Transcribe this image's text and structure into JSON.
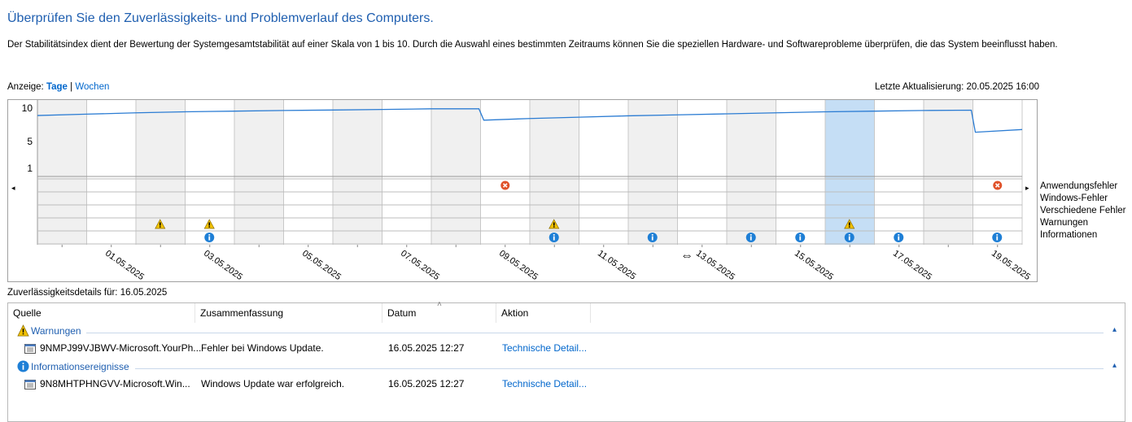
{
  "header": {
    "title": "Überprüfen Sie den Zuverlässigkeits- und Problemverlauf des Computers.",
    "description": "Der Stabilitätsindex dient der Bewertung der Systemgesamtstabilität auf einer Skala von 1 bis 10. Durch die Auswahl eines bestimmten Zeitraums können Sie die speziellen Hardware- und Softwareprobleme überprüfen, die das System beeinflusst haben."
  },
  "view": {
    "label": "Anzeige:",
    "days": "Tage",
    "separator": "|",
    "weeks": "Wochen",
    "last_update": "Letzte Aktualisierung: 20.05.2025 16:00"
  },
  "chart": {
    "y_ticks": [
      "10",
      "5",
      "1"
    ],
    "legend": [
      "Anwendungsfehler",
      "Windows-Fehler",
      "Verschiedene Fehler",
      "Warnungen",
      "Informationen"
    ],
    "nav_left": "◂",
    "nav_right": "▸"
  },
  "chart_data": {
    "type": "line",
    "title": "",
    "ylim": [
      1,
      10
    ],
    "x": [
      "30.04.2025",
      "01.05.2025",
      "02.05.2025",
      "03.05.2025",
      "04.05.2025",
      "05.05.2025",
      "06.05.2025",
      "07.05.2025",
      "08.05.2025",
      "09.05.2025",
      "10.05.2025",
      "11.05.2025",
      "12.05.2025",
      "13.05.2025",
      "14.05.2025",
      "15.05.2025",
      "16.05.2025",
      "17.05.2025",
      "18.05.2025",
      "19.05.2025"
    ],
    "x_tick_labels": [
      "01.05.2025",
      "03.05.2025",
      "05.05.2025",
      "07.05.2025",
      "09.05.2025",
      "11.05.2025",
      "13.05.2025",
      "15.05.2025",
      "17.05.2025",
      "19.05.2025"
    ],
    "series": [
      {
        "values": [
          8.9,
          9.1,
          9.3,
          9.45,
          9.55,
          9.65,
          9.72,
          9.8,
          9.9,
          8.2,
          8.45,
          8.65,
          8.85,
          9.0,
          9.15,
          9.3,
          9.45,
          9.55,
          9.65,
          9.7
        ]
      }
    ],
    "stability_drop_end": 6.4,
    "selected_day": "16.05.2025",
    "events": {
      "Anwendungsfehler": [
        "09.05.2025",
        "19.05.2025"
      ],
      "Windows-Fehler": [],
      "Verschiedene Fehler": [],
      "Warnungen": [
        "02.05.2025",
        "03.05.2025",
        "10.05.2025",
        "16.05.2025"
      ],
      "Informationen": [
        "03.05.2025",
        "10.05.2025",
        "12.05.2025",
        "14.05.2025",
        "15.05.2025",
        "16.05.2025",
        "17.05.2025",
        "19.05.2025"
      ]
    }
  },
  "details": {
    "label": "Zuverlässigkeitsdetails für: 16.05.2025",
    "columns": [
      "Quelle",
      "Zusammenfassung",
      "Datum",
      "Aktion"
    ],
    "groups": [
      {
        "name": "Warnungen",
        "icon": "warning-icon",
        "rows": [
          {
            "source": "9NMPJ99VJBWV-Microsoft.YourPh...",
            "summary": "Fehler bei Windows Update.",
            "date": "16.05.2025 12:27",
            "action": "Technische Detail..."
          }
        ]
      },
      {
        "name": "Informationsereignisse",
        "icon": "info-icon",
        "rows": [
          {
            "source": "9N8MHTPHNGVV-Microsoft.Win...",
            "summary": "Windows Update war erfolgreich.",
            "date": "16.05.2025 12:27",
            "action": "Technische Detail..."
          }
        ]
      }
    ]
  },
  "colors": {
    "accent": "#1f5fb0",
    "link": "#0066cc",
    "line": "#2b7cd3",
    "selected": "#c5def5",
    "error": "#e0522a",
    "warning": "#f2c200",
    "info": "#1e7fd6"
  }
}
